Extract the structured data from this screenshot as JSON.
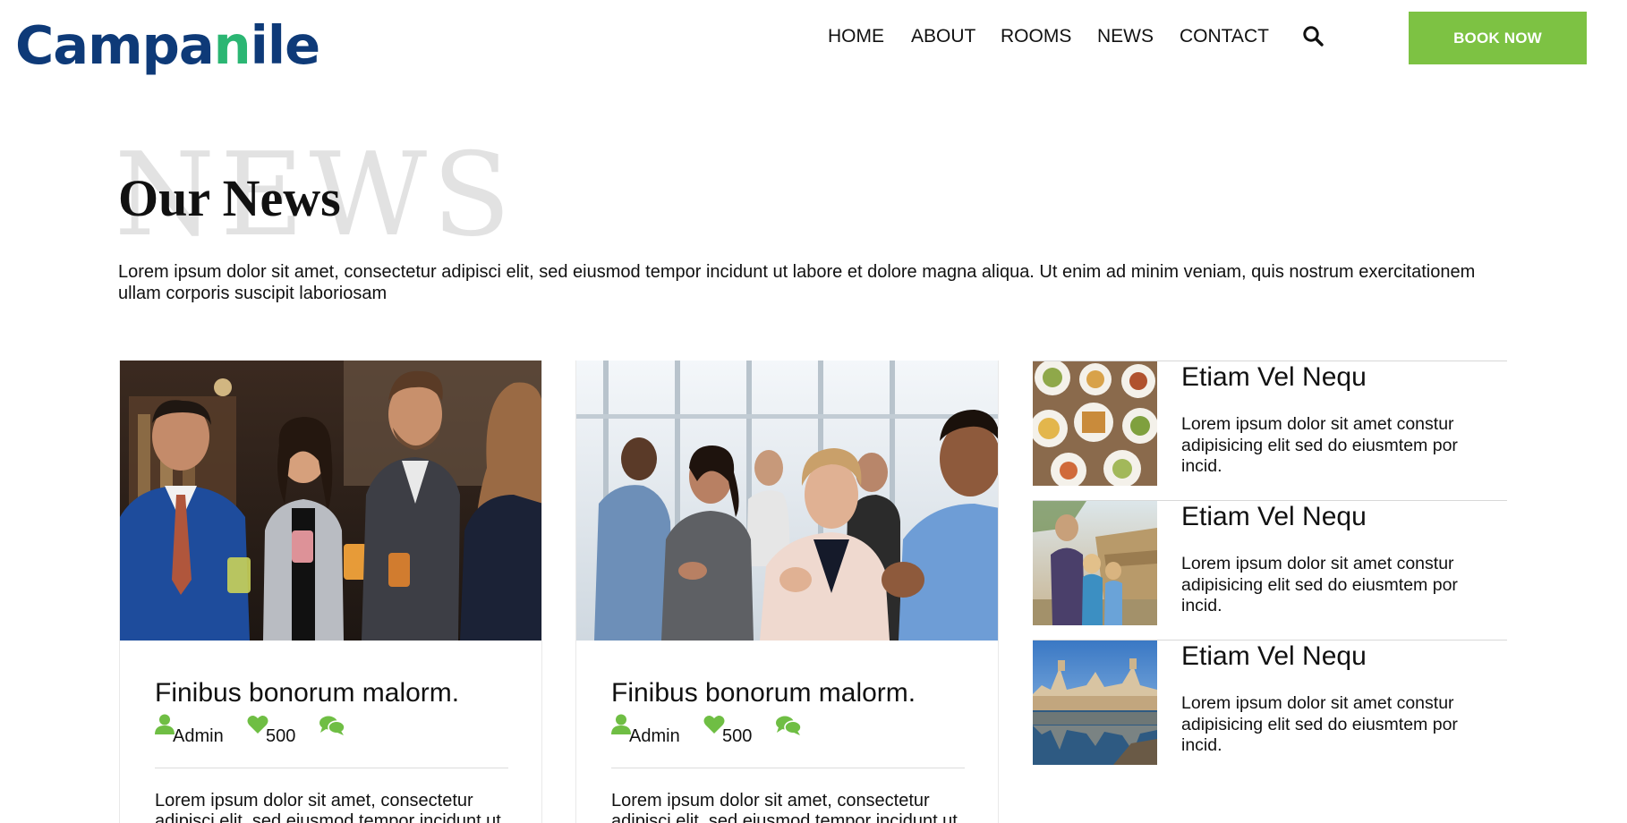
{
  "brand": {
    "logo_text_before": "Campa",
    "logo_text_n": "n",
    "logo_text_after": "ile",
    "logo_primary_color": "#0e3a78",
    "logo_accent_color": "#2bb673"
  },
  "nav": {
    "items": [
      {
        "label": "HOME"
      },
      {
        "label": "ABOUT"
      },
      {
        "label": "ROOMS"
      },
      {
        "label": "NEWS"
      },
      {
        "label": "CONTACT"
      }
    ],
    "search_icon": "search-icon",
    "book_label": "BOOK NOW",
    "book_color": "#7dc243"
  },
  "section": {
    "watermark": "NEWS",
    "title": "Our News",
    "intro": "Lorem ipsum dolor sit amet, consectetur adipisci elit, sed eiusmod tempor incidunt ut labore et dolore magna aliqua. Ut enim ad minim veniam, quis nostrum exercitationem ullam corporis suscipit laboriosam"
  },
  "cards": [
    {
      "image": "photo-business-people-drinks",
      "title": "Finibus bonorum malorm.",
      "author": "Admin",
      "likes": "500",
      "excerpt": "Lorem ipsum dolor sit amet, consectetur adipisci elit, sed eiusmod tempor incidunt ut"
    },
    {
      "image": "photo-audience-applauding",
      "title": "Finibus bonorum malorm.",
      "author": "Admin",
      "likes": "500",
      "excerpt": "Lorem ipsum dolor sit amet, consectetur adipisci elit, sed eiusmod tempor incidunt ut"
    }
  ],
  "side_posts": [
    {
      "image": "photo-food-plates",
      "title": "Etiam Vel Nequ",
      "text": "Lorem ipsum dolor sit amet constur adipisicing elit sed do eiusmtem por incid."
    },
    {
      "image": "photo-family-travel",
      "title": "Etiam Vel Nequ",
      "text": "Lorem ipsum dolor sit amet constur adipisicing elit sed do eiusmtem por incid."
    },
    {
      "image": "photo-palace-reflection",
      "title": "Etiam Vel Nequ",
      "text": "Lorem ipsum dolor sit amet constur adipisicing elit sed do eiusmtem por incid."
    }
  ],
  "colors": {
    "accent_green": "#7dc243",
    "icon_green": "#6fbe44",
    "text": "#111111",
    "watermark": "#e2e2e2"
  }
}
